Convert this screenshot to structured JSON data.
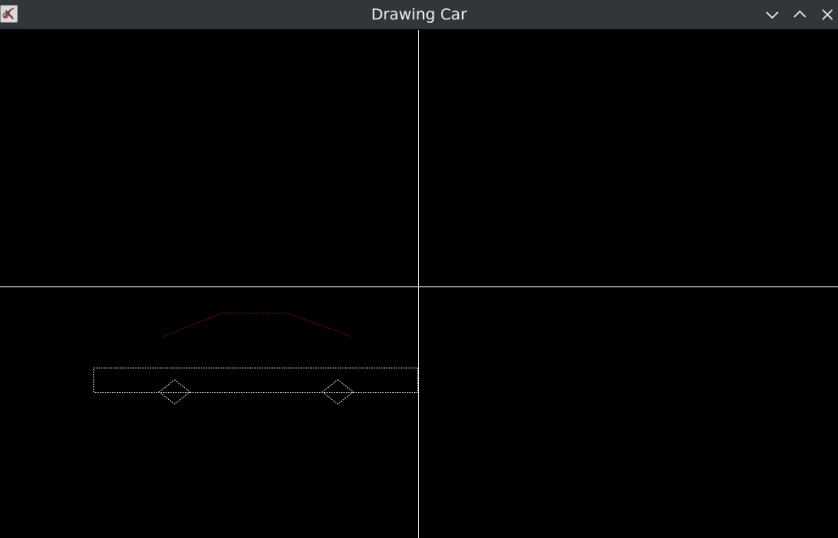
{
  "window": {
    "title": "Drawing Car",
    "app_icon": "xfig-icon",
    "controls": {
      "minimize_icon": "chevron-down-icon",
      "maximize_icon": "chevron-up-icon",
      "close_icon": "close-icon"
    }
  },
  "canvas": {
    "background_color": "#000000",
    "axis_color": "#ffffff",
    "car_body_color": "#ffffff",
    "car_roof_color": "#a01010",
    "car_wheel_color": "#ffffff"
  }
}
